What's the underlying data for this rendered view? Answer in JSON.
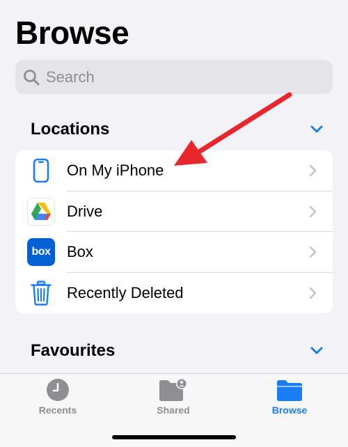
{
  "header": {
    "title": "Browse"
  },
  "search": {
    "placeholder": "Search"
  },
  "locations": {
    "title": "Locations",
    "items": [
      {
        "label": "On My iPhone",
        "icon": "iphone-icon"
      },
      {
        "label": "Drive",
        "icon": "google-drive-icon"
      },
      {
        "label": "Box",
        "icon": "box-icon",
        "icon_text": "box"
      },
      {
        "label": "Recently Deleted",
        "icon": "trash-icon"
      }
    ]
  },
  "favourites": {
    "title": "Favourites"
  },
  "tabbar": {
    "tabs": [
      {
        "label": "Recents",
        "icon": "clock-icon",
        "active": false
      },
      {
        "label": "Shared",
        "icon": "shared-folder-icon",
        "active": false
      },
      {
        "label": "Browse",
        "icon": "folder-icon",
        "active": true
      }
    ]
  },
  "colors": {
    "accent": "#1a7cf5",
    "background": "#f2f2f7",
    "annotation_arrow": "#e8262d",
    "inactive_tab": "#8e8e93"
  }
}
